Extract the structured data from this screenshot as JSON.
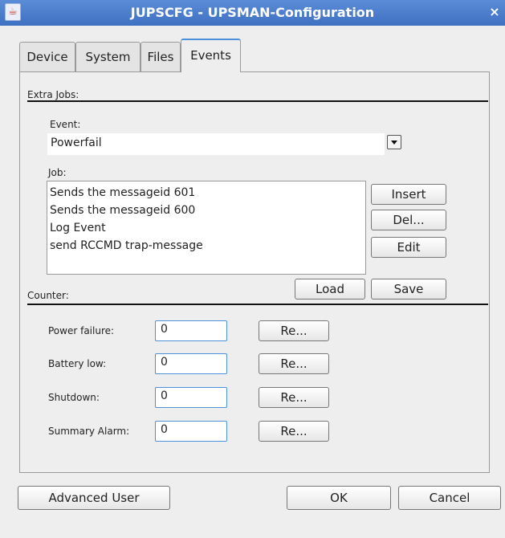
{
  "window": {
    "title": "JUPSCFG - UPSMAN-Configuration",
    "close_label": "×"
  },
  "tabs": [
    {
      "label": "Device"
    },
    {
      "label": "System"
    },
    {
      "label": "Files"
    },
    {
      "label": "Events",
      "active": true
    }
  ],
  "extra_jobs": {
    "section_label": "Extra Jobs:",
    "event_label": "Event:",
    "event_value": "Powerfail",
    "job_label": "Job:",
    "jobs": [
      "Sends the messageid 601",
      "Sends the messageid 600",
      "Log Event",
      "send RCCMD trap-message"
    ],
    "insert_label": "Insert",
    "del_label": "Del...",
    "edit_label": "Edit",
    "load_label": "Load",
    "save_label": "Save"
  },
  "counter": {
    "section_label": "Counter:",
    "rows": [
      {
        "label": "Power failure:",
        "value": "0",
        "reset_label": "Re..."
      },
      {
        "label": "Battery low:",
        "value": "0",
        "reset_label": "Re..."
      },
      {
        "label": "Shutdown:",
        "value": "0",
        "reset_label": "Re..."
      },
      {
        "label": "Summary Alarm:",
        "value": "0",
        "reset_label": "Re..."
      }
    ]
  },
  "footer": {
    "advanced_user_label": "Advanced User",
    "ok_label": "OK",
    "cancel_label": "Cancel"
  },
  "colors": {
    "title_bar": "#4a7ccb",
    "background": "#eeeeee",
    "focus_blue": "#4d8fd8"
  },
  "icons": {
    "app": "java-cup-icon",
    "close": "close-icon",
    "dropdown": "chevron-down-icon"
  }
}
